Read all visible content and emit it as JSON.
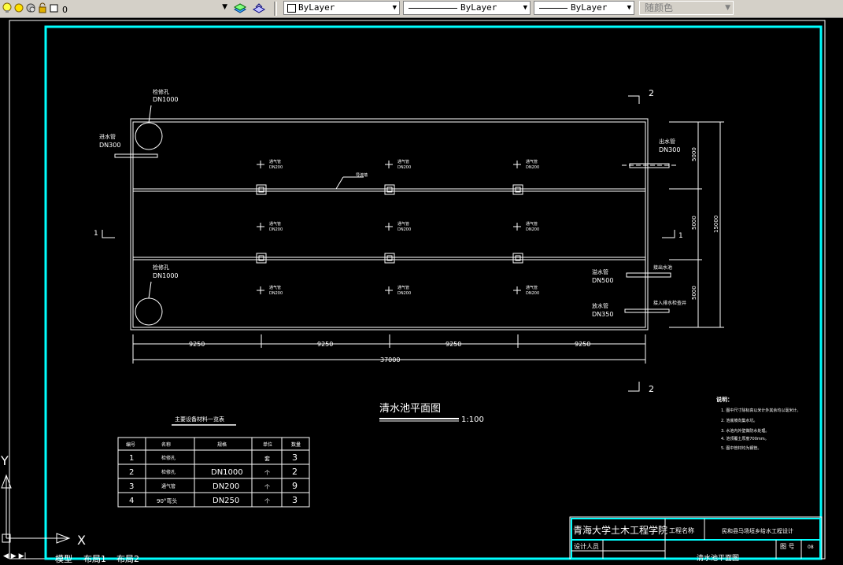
{
  "toolbar": {
    "layer_value": "0",
    "color_value": "ByLayer",
    "linetype_value": "ByLayer",
    "lineweight_value": "ByLayer",
    "plotstyle_value": "随颜色"
  },
  "drawing": {
    "title": "清水池平面图",
    "scale": "1:100",
    "section_labels": [
      "1",
      "1",
      "2",
      "2"
    ],
    "overflow_label": "检修孔",
    "overflow_dn": "DN1000",
    "inlet_left_label": "进水管",
    "inlet_left_dn": "DN300",
    "outlet_right_label": "出水管",
    "outlet_right_dn": "DN300",
    "drain_label": "溢水管",
    "drain_dn": "DN500",
    "vent_label": "放水管",
    "vent_dn": "DN350",
    "pipe_label": "通气管",
    "pipe_dn": "DN200",
    "beam_label": "导流墙",
    "drain_note": "接出水池",
    "vent_note": "接入排水检查井",
    "dims_bottom": [
      "9250",
      "9250",
      "9250",
      "9250"
    ],
    "dim_total": "37000",
    "dims_right": [
      "5000",
      "5000",
      "5000"
    ],
    "dim_right_total": "15000",
    "axis_x": "X",
    "axis_y": "Y"
  },
  "table": {
    "title": "主要设备材料一览表",
    "headers": [
      "编号",
      "名称",
      "规格",
      "单位",
      "数量"
    ],
    "rows": [
      [
        "1",
        "检修孔",
        "",
        "套",
        "3"
      ],
      [
        "2",
        "检修孔",
        "DN1000",
        "个",
        "2"
      ],
      [
        "3",
        "通气管",
        "DN200",
        "个",
        "9"
      ],
      [
        "4",
        "90°弯头",
        "DN250",
        "个",
        "3"
      ]
    ]
  },
  "notes": {
    "title": "说明：",
    "items": [
      "1.  图中尺寸除标高以米计外其余均以毫米计。",
      "2.  池底坡向集水坑。",
      "3.  水池内外壁做防水处理。",
      "4.  池顶覆土厚度700mm。",
      "5.  图中管材均为钢管。"
    ]
  },
  "titleblock": {
    "school": "青海大学土木工程学院",
    "project_label": "工程名称",
    "project_name": "民和县马场垣乡给水工程设计",
    "designer_label": "设计人员",
    "drawing_no_label": "图 号",
    "drawing_no": "08",
    "drawing_name": "清水池平面图"
  },
  "tabs": [
    "模型",
    "布局1",
    "布局2"
  ]
}
